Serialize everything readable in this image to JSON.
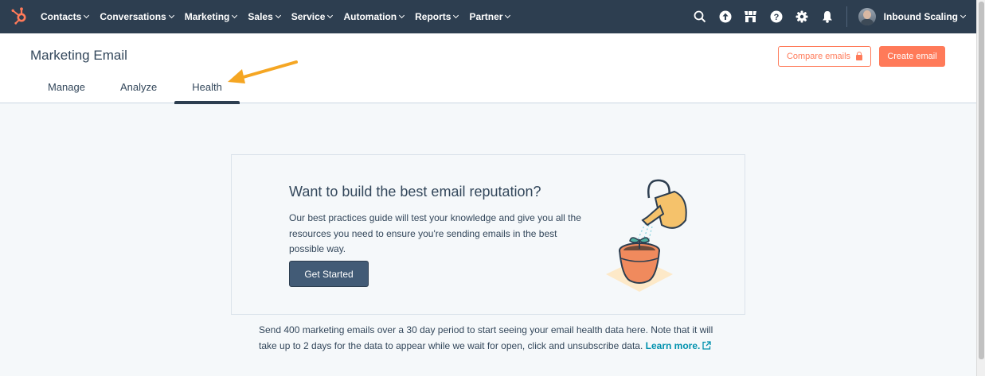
{
  "topnav": {
    "items": [
      {
        "label": "Contacts"
      },
      {
        "label": "Conversations"
      },
      {
        "label": "Marketing"
      },
      {
        "label": "Sales"
      },
      {
        "label": "Service"
      },
      {
        "label": "Automation"
      },
      {
        "label": "Reports"
      },
      {
        "label": "Partner"
      }
    ],
    "icons": [
      "search-icon",
      "upgrade-icon",
      "marketplace-icon",
      "help-icon",
      "settings-icon",
      "notifications-icon"
    ],
    "account_name": "Inbound Scaling"
  },
  "header": {
    "title": "Marketing Email",
    "tabs": [
      {
        "label": "Manage",
        "active": false
      },
      {
        "label": "Analyze",
        "active": false
      },
      {
        "label": "Health",
        "active": true
      }
    ],
    "compare_button": "Compare emails",
    "create_button": "Create email"
  },
  "card": {
    "title": "Want to build the best email reputation?",
    "body_lines": [
      "Our best practices guide will test your knowledge and give you all the",
      "resources you need to ensure you're sending emails in the best",
      "possible way."
    ],
    "cta": "Get Started"
  },
  "footnote": {
    "line1": "Send 400 marketing emails over a 30 day period to start seeing your email health data here. Note that it will",
    "line2": "take up to 2 days for the data to appear while we wait for open, click and unsubscribe data.",
    "link": "Learn more."
  },
  "colors": {
    "nav_bg": "#2d3e50",
    "accent": "#ff7a59",
    "primary_dark": "#425b76",
    "link": "#0091ae",
    "annotation_arrow": "#f5a623"
  }
}
